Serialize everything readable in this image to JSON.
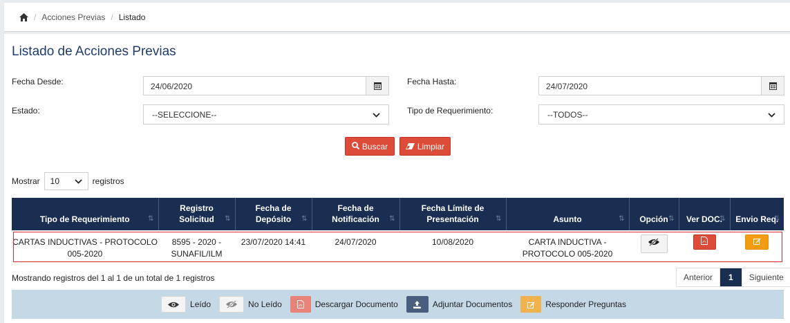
{
  "breadcrumb": {
    "items": [
      "Acciones Previas",
      "Listado"
    ]
  },
  "page": {
    "title": "Listado de Acciones Previas"
  },
  "filters": {
    "fecha_desde_label": "Fecha Desde:",
    "fecha_desde_value": "24/06/2020",
    "fecha_hasta_label": "Fecha Hasta:",
    "fecha_hasta_value": "24/07/2020",
    "estado_label": "Estado:",
    "estado_value": "--SELECCIONE--",
    "tipo_label": "Tipo de Requerimiento:",
    "tipo_value": "--TODOS--"
  },
  "actions": {
    "buscar": "Buscar",
    "limpiar": "Limpiar"
  },
  "length": {
    "prefix": "Mostrar",
    "value": "10",
    "suffix": "registros"
  },
  "table": {
    "headers": [
      "Tipo de Requerimiento",
      "Registro Solicitud",
      "Fecha de Depósito",
      "Fecha de Notificación",
      "Fecha Límite de Presentación",
      "Asunto",
      "Opción",
      "Ver DOC.",
      "Envio Req."
    ],
    "rows": [
      {
        "tipo": "CARTAS INDUCTIVAS - PROTOCOLO 005-2020",
        "registro": "8595 - 2020 - SUNAFIL/ILM",
        "deposito": "23/07/2020 14:41",
        "notificacion": "24/07/2020",
        "limite": "10/08/2020",
        "asunto": "CARTA INDUCTIVA - PROTOCOLO 005-2020"
      }
    ]
  },
  "info": "Mostrando registros del 1 al 1 de un total de 1 registros",
  "pager": {
    "prev": "Anterior",
    "current": "1",
    "next": "Siguiente"
  },
  "legend": {
    "leido": "Leído",
    "no_leido": "No Leído",
    "descargar": "Descargar Documento",
    "adjuntar": "Adjuntar Documentos",
    "responder": "Responder Preguntas"
  },
  "colors": {
    "header": "#1a2e52",
    "danger": "#dd4b39",
    "warning": "#f39c12",
    "title": "#1f3b6e"
  },
  "icons": [
    "home-icon",
    "calendar-icon",
    "chevron-down-icon",
    "search-icon",
    "eraser-icon",
    "sort-icon",
    "eye-slash-icon",
    "pdf-icon",
    "edit-icon",
    "eye-icon",
    "upload-icon"
  ]
}
